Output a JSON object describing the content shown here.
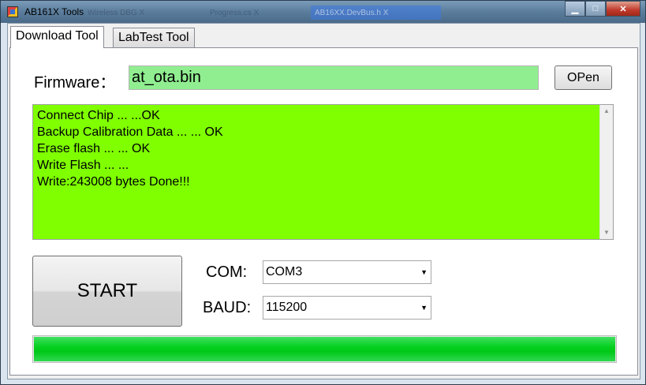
{
  "window": {
    "title": "AB161X Tools",
    "ghost_titles": [
      "Wireless DBG X",
      "Progress.cs X",
      "AB16XX.DevBus.h X"
    ]
  },
  "caption_buttons": {
    "minimize": "▁",
    "maximize": "□",
    "close": "✕"
  },
  "tabs": [
    {
      "label": "Download Tool",
      "active": true
    },
    {
      "label": "LabTest Tool",
      "active": false
    }
  ],
  "firmware": {
    "label": "Firmware：",
    "value": "at_ota.bin",
    "open_button": "OPen",
    "field_color": "#90ee90"
  },
  "log": {
    "background": "#7fff00",
    "lines": [
      "Connect Chip ... ...OK",
      "Backup Calibration Data ... ... OK",
      "Erase flash ... ... OK",
      "Write Flash ... ...",
      "Write:243008 bytes Done!!!"
    ]
  },
  "start_button": "START",
  "com": {
    "label": "COM:",
    "selected": "COM3"
  },
  "baud": {
    "label": "BAUD:",
    "selected": "115200"
  },
  "progress": {
    "value": 1.0,
    "color": "#00c818"
  }
}
